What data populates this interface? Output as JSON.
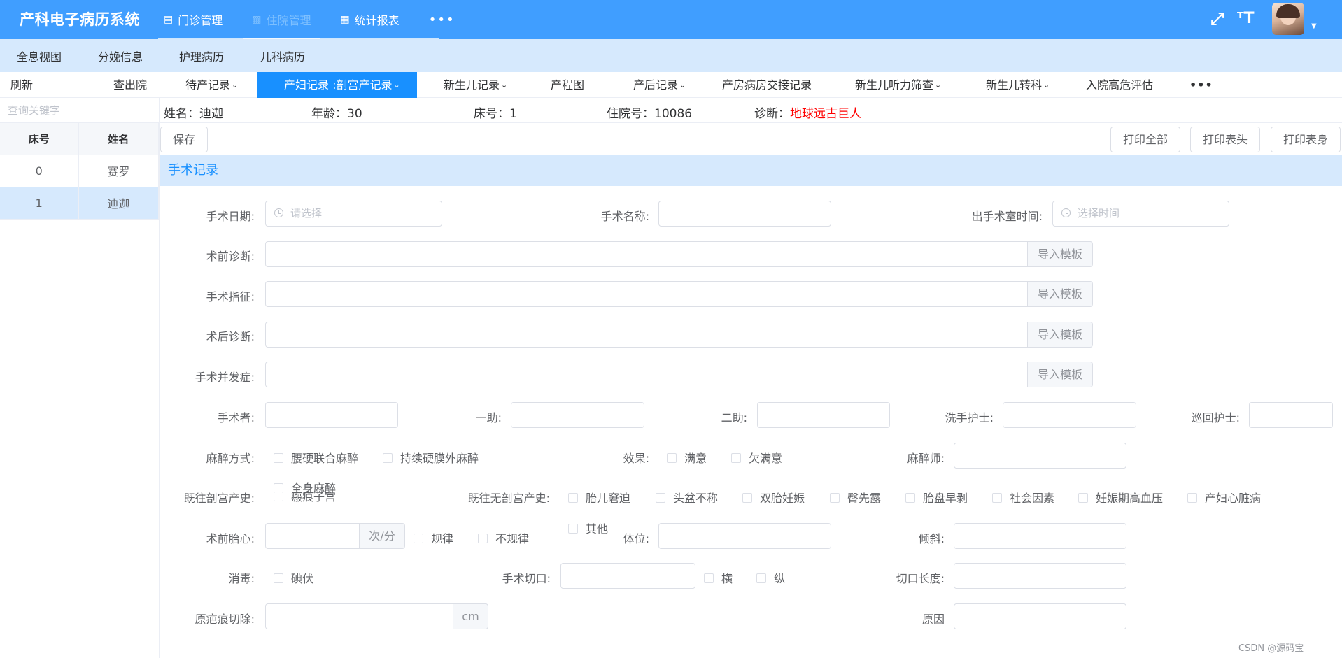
{
  "app": {
    "title": "产科电子病历系统"
  },
  "top_menu": [
    {
      "icon": "list-icon",
      "label": "门诊管理"
    },
    {
      "icon": "bar-chart-icon",
      "label": "住院管理"
    },
    {
      "icon": "table-icon",
      "label": "统计报表"
    }
  ],
  "top_icons": {
    "fullscreen": "fullscreen-icon",
    "font_size": "font-size-icon",
    "more": "•••"
  },
  "subnav": [
    "全息视图",
    "分娩信息",
    "护理病历",
    "儿科病历"
  ],
  "tabs": {
    "refresh": "刷新",
    "discharge": "查出院",
    "items": [
      "待产记录",
      "产妇记录 :剖宫产记录",
      "新生儿记录",
      "产程图",
      "产后记录",
      "产房病房交接记录",
      "新生儿听力筛查",
      "新生儿转科",
      "入院高危评估"
    ],
    "more": "•••"
  },
  "search": {
    "placeholder": "查询关键字"
  },
  "patients": {
    "headers": [
      "床号",
      "姓名"
    ],
    "rows": [
      {
        "bed": "0",
        "name": "赛罗"
      },
      {
        "bed": "1",
        "name": "迪迦"
      }
    ],
    "selected_index": 1
  },
  "patient_info": {
    "name": "姓名：迪迦",
    "age": "年龄：30",
    "bed": "床号：1",
    "admission_no": "住院号：10086",
    "diagnosis_label": "诊断：",
    "diagnosis_value": "地球远古巨人"
  },
  "toolbar": {
    "save": "保存",
    "print_all": "打印全部",
    "print_header": "打印表头",
    "print_body": "打印表身"
  },
  "section": {
    "title": "手术记录"
  },
  "form": {
    "surgery_date": {
      "label": "手术日期:",
      "placeholder": "请选择"
    },
    "surgery_name": {
      "label": "手术名称:"
    },
    "exit_time": {
      "label": "出手术室时间:",
      "placeholder": "选择时间"
    },
    "preop_diag": {
      "label": "术前诊断:"
    },
    "indication": {
      "label": "手术指征:"
    },
    "postop_diag": {
      "label": "术后诊断:"
    },
    "complication": {
      "label": "手术并发症:"
    },
    "import_template": "导入模板",
    "surgeon": "手术者:",
    "assistant1": "一助:",
    "assistant2": "二助:",
    "scrub_nurse": "洗手护士:",
    "circulating_nurse": "巡回护士:",
    "anesthesia": {
      "label": "麻醉方式:",
      "options": [
        "腰硬联合麻醉",
        "持续硬膜外麻醉",
        "全身麻醉"
      ]
    },
    "effect": {
      "label": "效果:",
      "options": [
        "满意",
        "欠满意"
      ]
    },
    "anesthetist": "麻醉师:",
    "prior_cs": {
      "label": "既往剖宫产史:",
      "options": [
        "瘢痕子宫"
      ]
    },
    "no_prior_cs": {
      "label": "既往无剖宫产史:",
      "options": [
        "胎儿窘迫",
        "头盆不称",
        "双胎妊娠",
        "臀先露",
        "胎盘早剥",
        "社会因素",
        "妊娠期高血压",
        "产妇心脏病",
        "其他"
      ]
    },
    "fetal_heart": {
      "label": "术前胎心:",
      "unit": "次/分",
      "options": [
        "规律",
        "不规律"
      ]
    },
    "position": "体位:",
    "tilt": "倾斜:",
    "disinfection": {
      "label": "消毒:",
      "options": [
        "碘伏"
      ]
    },
    "incision": {
      "label": "手术切口:",
      "options": [
        "横",
        "纵"
      ]
    },
    "incision_length": "切口长度:",
    "scar_excision": {
      "label": "原疤痕切除:",
      "unit": "cm"
    },
    "reason": "原因"
  },
  "watermark": "CSDN @源码宝"
}
